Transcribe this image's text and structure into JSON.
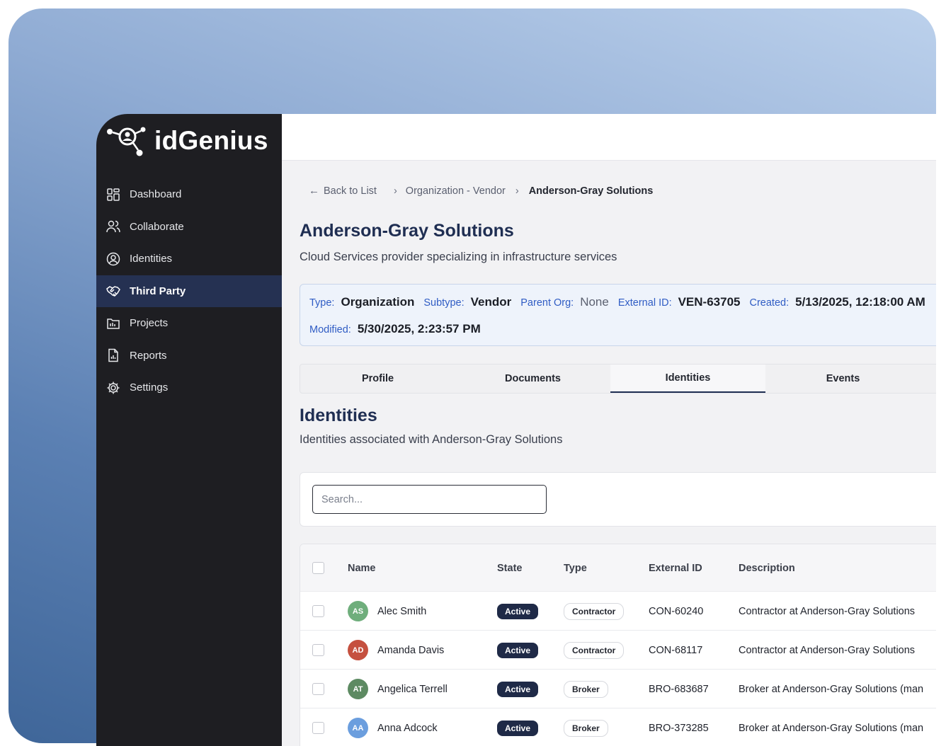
{
  "brand": {
    "name": "idGenius"
  },
  "sidebar": {
    "items": [
      {
        "label": "Dashboard",
        "icon": "dashboard-icon",
        "active": false
      },
      {
        "label": "Collaborate",
        "icon": "users-icon",
        "active": false
      },
      {
        "label": "Identities",
        "icon": "user-circle-icon",
        "active": false
      },
      {
        "label": "Third Party",
        "icon": "handshake-icon",
        "active": true
      },
      {
        "label": "Projects",
        "icon": "folder-icon",
        "active": false
      },
      {
        "label": "Reports",
        "icon": "report-icon",
        "active": false
      },
      {
        "label": "Settings",
        "icon": "gear-icon",
        "active": false
      }
    ]
  },
  "breadcrumb": {
    "back": "Back to List",
    "section": "Organization - Vendor",
    "current": "Anderson-Gray Solutions"
  },
  "header": {
    "title": "Anderson-Gray Solutions",
    "subtitle": "Cloud Services provider specializing in infrastructure services"
  },
  "meta": {
    "type_label": "Type:",
    "type_value": "Organization",
    "subtype_label": "Subtype:",
    "subtype_value": "Vendor",
    "parent_label": "Parent Org:",
    "parent_value": "None",
    "external_label": "External ID:",
    "external_value": "VEN-63705",
    "created_label": "Created:",
    "created_value": "5/13/2025, 12:18:00 AM",
    "modified_label": "Modified:",
    "modified_value": "5/30/2025, 2:23:57 PM"
  },
  "tabs": [
    {
      "label": "Profile",
      "active": false
    },
    {
      "label": "Documents",
      "active": false
    },
    {
      "label": "Identities",
      "active": true
    },
    {
      "label": "Events",
      "active": false
    }
  ],
  "section": {
    "title": "Identities",
    "subtitle": "Identities associated with Anderson-Gray Solutions"
  },
  "search": {
    "placeholder": "Search..."
  },
  "table": {
    "columns": [
      "Name",
      "State",
      "Type",
      "External ID",
      "Description"
    ],
    "rows": [
      {
        "initials": "AS",
        "avatar_color": "#6fae7c",
        "name": "Alec Smith",
        "state": "Active",
        "type": "Contractor",
        "external_id": "CON-60240",
        "description": "Contractor at Anderson-Gray Solutions"
      },
      {
        "initials": "AD",
        "avatar_color": "#c5503f",
        "name": "Amanda Davis",
        "state": "Active",
        "type": "Contractor",
        "external_id": "CON-68117",
        "description": "Contractor at Anderson-Gray Solutions"
      },
      {
        "initials": "AT",
        "avatar_color": "#5d8a62",
        "name": "Angelica Terrell",
        "state": "Active",
        "type": "Broker",
        "external_id": "BRO-683687",
        "description": "Broker at Anderson-Gray Solutions (man"
      },
      {
        "initials": "AA",
        "avatar_color": "#6b9ede",
        "name": "Anna Adcock",
        "state": "Active",
        "type": "Broker",
        "external_id": "BRO-373285",
        "description": "Broker at Anderson-Gray Solutions (man"
      }
    ]
  }
}
